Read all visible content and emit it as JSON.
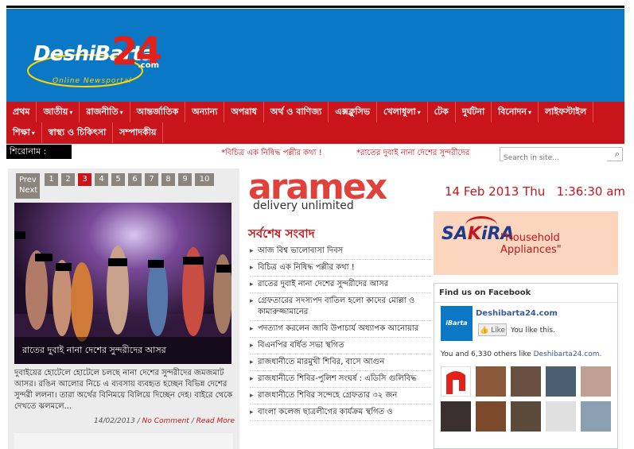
{
  "header": {
    "logo_main": "DeshiBarta",
    "logo_num": "24",
    "logo_domain": ".com",
    "logo_tagline": "Online Newsportal"
  },
  "nav": {
    "row1": [
      {
        "label": "প্রথম",
        "dropdown": false
      },
      {
        "label": "জাতীয়",
        "dropdown": true
      },
      {
        "label": "রাজনীতি",
        "dropdown": true
      },
      {
        "label": "আন্তর্জাতিক",
        "dropdown": false
      },
      {
        "label": "অন্যান্য",
        "dropdown": false
      },
      {
        "label": "অপরাধ",
        "dropdown": false
      },
      {
        "label": "অর্থ ও বাণিজ্য",
        "dropdown": false
      },
      {
        "label": "এক্সক্লুসিভ",
        "dropdown": false
      },
      {
        "label": "খেলাধুলা",
        "dropdown": true
      },
      {
        "label": "টেক",
        "dropdown": false
      },
      {
        "label": "দুর্ঘটনা",
        "dropdown": false
      },
      {
        "label": "বিনোদন",
        "dropdown": true
      },
      {
        "label": "লাইফস্টাইল",
        "dropdown": false
      }
    ],
    "row2": [
      {
        "label": "শিক্ষা",
        "dropdown": true
      },
      {
        "label": "স্বাস্থ্য ও চিকিৎসা",
        "dropdown": false
      },
      {
        "label": "সম্পাদকীয়",
        "dropdown": false
      }
    ]
  },
  "ticker": {
    "label": "শিরোনাম :",
    "item1": "*বিচিত্র এক নিষিদ্ধ পল্লীর কথা !",
    "item2": "*রাতের দুবাই নানা দেশের সুন্দরীদের",
    "search_placeholder": "Search in site..."
  },
  "slider": {
    "prev_label": "Prev",
    "next_label": "Next",
    "pages": [
      "1",
      "2",
      "3",
      "4",
      "5",
      "6",
      "7",
      "8",
      "9",
      "10"
    ],
    "active_page": "3",
    "caption": "রাতের দুবাই নানা দেশের সুন্দরীদের আসর",
    "summary": "দুবাইয়ের হোটেলে হোটেলে চলছে নানা দেশের সুন্দরীদের জমজমাট আসর। রঙিন আলোর নিচে এ ব্যবসায় ব্যবহৃত হচ্ছেন বিভিন্ন দেশের সুন্দরী ললনা। তারা অর্থের বিনিময়ে বিলিয়ে দিচ্ছেন দেহ। বাইরে থেকে দেখতে ঝলমলে...",
    "date": "14/02/2013",
    "sep": " / ",
    "comment_link": "No Comment",
    "read_more": "Read More"
  },
  "ad_aramex": {
    "brand": "aramex",
    "tagline": "delivery unlimited"
  },
  "latest": {
    "title": "সর্বশেষ সংবাদ",
    "items": [
      "আজ বিশ্ব ভালোবাসা দিবস",
      "বিচিত্র এক নিষিদ্ধ পল্লীর কথা !",
      "রাতের দুবাই নানা দেশের সুন্দরীদের আসর",
      "গ্রেফতারের সদস্যপদ বাতিল হলো কাদের মোল্লা ও কামারুজ্জামানের",
      "পদত্যাগ করলেন জাবি উপাচার্য অধ্যাপক আনোয়ার",
      "বিএনপির বর্ধিত সভা স্থগিত",
      "রাজধানীতে মারমুখী শিবির, বাসে আগুন",
      "রাজধানীতে শিবির-পুলিশ সংঘর্ষ : এডিসি গুলিবিদ্ধ",
      "রাজধানীতে শিবির সন্দেহে গ্রেফতার ৩২ জন",
      "বাংলা কলেজ ছাত্রলীগের কার্যক্রম স্থগিত ও"
    ]
  },
  "datetime": {
    "date": "14 Feb 2013 Thu",
    "time": "1:36:30 am"
  },
  "ad_sakira": {
    "brand_a": "SA",
    "brand_b": "K",
    "brand_c": "iRA",
    "slogan": "\"Household Appliances\""
  },
  "facebook": {
    "title": "Find us on Facebook",
    "page_thumb": "iBarta",
    "page_name": "Deshibarta24.com",
    "like_label": "Like",
    "you_like": "You like this.",
    "count_text": "You and 6,330 others like ",
    "count_link": "Deshibarta24.com."
  }
}
